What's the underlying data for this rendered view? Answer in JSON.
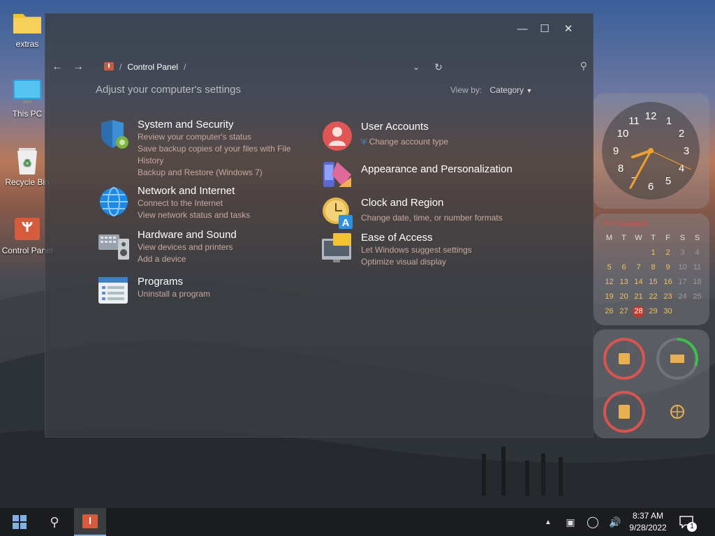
{
  "desktop": {
    "icons": [
      {
        "label": "extras"
      },
      {
        "label": "This PC"
      },
      {
        "label": "Recycle Bin"
      },
      {
        "label": "Control Panel"
      }
    ]
  },
  "window": {
    "breadcrumb": {
      "root_sep": "/",
      "current": "Control Panel",
      "trail_sep": "/"
    },
    "search": {
      "placeholder": ""
    },
    "heading": "Adjust your computer's settings",
    "view_by": {
      "label": "View by:",
      "value": "Category"
    },
    "categories": [
      {
        "title": "System and Security",
        "links": [
          "Review your computer's status",
          "Save backup copies of your files with File",
          "History",
          "Backup and Restore (Windows 7)"
        ]
      },
      {
        "title": "Network and Internet",
        "links": [
          "Connect to the Internet",
          "View network status and tasks"
        ]
      },
      {
        "title": "Hardware and Sound",
        "links": [
          "View devices and printers",
          "Add a device"
        ]
      },
      {
        "title": "Programs",
        "links": [
          "Uninstall a program"
        ]
      },
      {
        "title": "User Accounts",
        "links": [
          "Change account type"
        ]
      },
      {
        "title": "Appearance and Personalization",
        "links": []
      },
      {
        "title": "Clock and Region",
        "links": [
          "Change date, time, or number formats"
        ]
      },
      {
        "title": "Ease of Access",
        "links": [
          "Let Windows suggest settings",
          "Optimize visual display"
        ]
      }
    ]
  },
  "widgets": {
    "clock_numbers": [
      "12",
      "1",
      "2",
      "3",
      "4",
      "5",
      "6",
      "7",
      "8",
      "9",
      "10",
      "11"
    ],
    "calendar": {
      "month": "SEPTEMBER",
      "weekdays": [
        "M",
        "T",
        "W",
        "T",
        "F",
        "S",
        "S"
      ],
      "rows": [
        [
          "",
          "",
          "",
          "1",
          "2",
          "3",
          "4"
        ],
        [
          "5",
          "6",
          "7",
          "8",
          "9",
          "10",
          "11"
        ],
        [
          "12",
          "13",
          "14",
          "15",
          "16",
          "17",
          "18"
        ],
        [
          "19",
          "20",
          "21",
          "22",
          "23",
          "24",
          "25"
        ],
        [
          "26",
          "27",
          "28",
          "29",
          "30",
          "",
          ""
        ]
      ],
      "today": "28"
    },
    "colors": {
      "accent_red": "#d9534f",
      "accent_green": "#3cc24a",
      "clock_hand": "#f0a030"
    }
  },
  "taskbar": {
    "time": "8:37 AM",
    "date": "9/28/2022",
    "notification_count": "1"
  }
}
